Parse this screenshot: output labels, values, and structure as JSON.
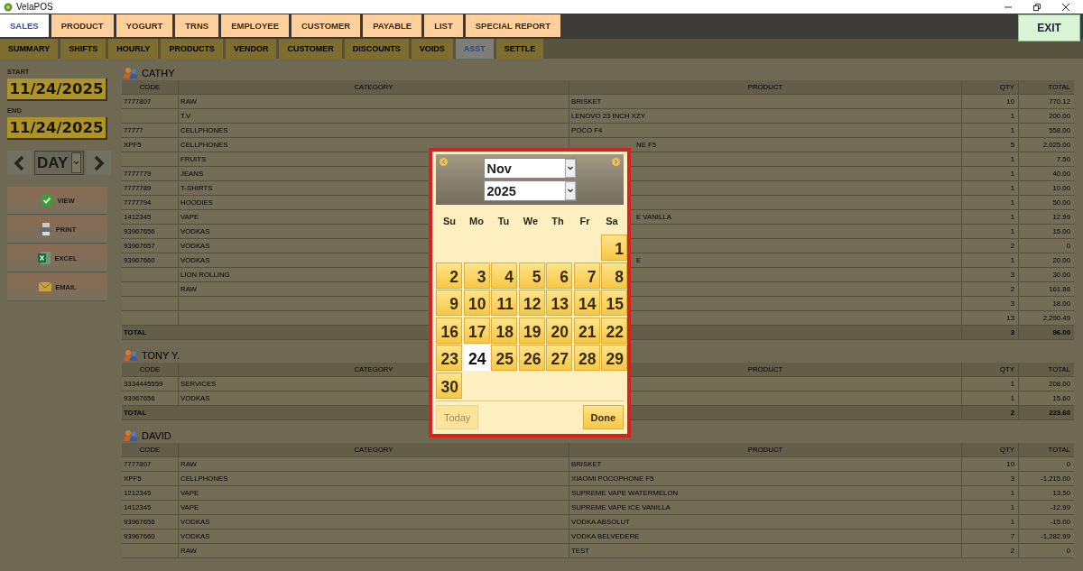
{
  "window": {
    "title": "VelaPOS"
  },
  "main_tabs": [
    {
      "label": "SALES",
      "selected": true
    },
    {
      "label": "PRODUCT",
      "selected": false
    },
    {
      "label": "YOGURT",
      "selected": false
    },
    {
      "label": "TRNS",
      "selected": false
    },
    {
      "label": "EMPLOYEE",
      "selected": false
    },
    {
      "label": "CUSTOMER",
      "selected": false
    },
    {
      "label": "PAYABLE",
      "selected": false
    },
    {
      "label": "LIST",
      "selected": false
    },
    {
      "label": "SPECIAL REPORT",
      "selected": false
    }
  ],
  "exit_button": "EXIT",
  "report_tabs": [
    {
      "label": "SUMMARY",
      "selected": false
    },
    {
      "label": "SHIFTS",
      "selected": false
    },
    {
      "label": "HOURLY",
      "selected": false
    },
    {
      "label": "PRODUCTS",
      "selected": false
    },
    {
      "label": "VENDOR",
      "selected": false
    },
    {
      "label": "CUSTOMER",
      "selected": false
    },
    {
      "label": "DISCOUNTS",
      "selected": false
    },
    {
      "label": "VOIDS",
      "selected": false
    },
    {
      "label": "ASST",
      "selected": true
    },
    {
      "label": "SETTLE",
      "selected": false
    }
  ],
  "sidebar": {
    "start_label": "START",
    "start_date": "11/24/2025",
    "end_label": "END",
    "end_date": "11/24/2025",
    "period": "DAY",
    "actions": [
      {
        "label": "VIEW",
        "kind": "view"
      },
      {
        "label": "PRINT",
        "kind": "print"
      },
      {
        "label": "EXCEL",
        "kind": "excel"
      },
      {
        "label": "EMAIL",
        "kind": "email"
      }
    ]
  },
  "groups": [
    {
      "name": "CATHY",
      "columns": [
        "CODE",
        "CATEGORY",
        "PRODUCT",
        "QTY",
        "TOTAL"
      ],
      "rows": [
        [
          "7777807",
          "RAW",
          "BRISKET",
          "10",
          "770.12"
        ],
        [
          "",
          "T.V",
          "LENOVO 23 INCH XZY",
          "1",
          "200.00"
        ],
        [
          "77777",
          "CELLPHONES",
          "POCO F4",
          "1",
          "558.00"
        ],
        [
          "XPF5",
          "CELLPHONES",
          "NE F5",
          "5",
          "2,025.00"
        ],
        [
          "",
          "FRUITS",
          "",
          "1",
          "7.50"
        ],
        [
          "7777779",
          "JEANS",
          "",
          "1",
          "40.00"
        ],
        [
          "7777789",
          "T-SHIRTS",
          "",
          "1",
          "10.00"
        ],
        [
          "7777794",
          "HOODIES",
          "",
          "1",
          "50.00"
        ],
        [
          "1412345",
          "VAPE",
          "E VANILLA",
          "1",
          "12.99"
        ],
        [
          "93967656",
          "VODKAS",
          "",
          "1",
          "15.00"
        ],
        [
          "93967657",
          "VODKAS",
          "",
          "2",
          "0"
        ],
        [
          "93967660",
          "VODKAS",
          "E",
          "1",
          "20.00"
        ],
        [
          "",
          "LION ROLLING",
          "",
          "3",
          "30.00"
        ],
        [
          "",
          "RAW",
          "",
          "2",
          "161.88"
        ],
        [
          "",
          "",
          "",
          "3",
          "18.00"
        ],
        [
          "",
          "",
          "",
          "13",
          "2,290.49"
        ]
      ],
      "total": {
        "label": "TOTAL",
        "qty": "3",
        "amount": "96.00"
      }
    },
    {
      "name": "TONY Y.",
      "columns": [
        "CODE",
        "CATEGORY",
        "PRODUCT",
        "QTY",
        "TOTAL"
      ],
      "rows": [
        [
          "3334445559",
          "SERVICES",
          "",
          "1",
          "208.00"
        ],
        [
          "93967656",
          "VODKAS",
          "",
          "1",
          "15.60"
        ]
      ],
      "total": {
        "label": "TOTAL",
        "qty": "2",
        "amount": "223.60"
      }
    },
    {
      "name": "DAVID",
      "columns": [
        "CODE",
        "CATEGORY",
        "PRODUCT",
        "QTY",
        "TOTAL"
      ],
      "rows": [
        [
          "7777807",
          "RAW",
          "BRISKET",
          "10",
          "0"
        ],
        [
          "XPF5",
          "CELLPHONES",
          "XIAOMI POCOPHONE F5",
          "3",
          "-1,215.00"
        ],
        [
          "1212345",
          "VAPE",
          "SUPREME VAPE WATERMELON",
          "1",
          "13.50"
        ],
        [
          "1412345",
          "VAPE",
          "SUPREME VAPE ICE VANILLA",
          "1",
          "-12.99"
        ],
        [
          "93967656",
          "VODKAS",
          "VODKA ABSOLUT",
          "1",
          "-15.00"
        ],
        [
          "93967660",
          "VODKAS",
          "VODKA BELVEDERE",
          "7",
          "-1,282.99"
        ],
        [
          "",
          "RAW",
          "TEST",
          "2",
          "0"
        ]
      ]
    }
  ],
  "datepicker": {
    "month": "Nov",
    "year": "2025",
    "weekdays": [
      "Su",
      "Mo",
      "Tu",
      "We",
      "Th",
      "Fr",
      "Sa"
    ],
    "weeks": [
      {
        "kind": "tail",
        "days": [
          {
            "label": "1",
            "selected": false
          }
        ]
      },
      {
        "kind": "full",
        "days": [
          {
            "label": "2",
            "selected": false
          },
          {
            "label": "3",
            "selected": false
          },
          {
            "label": "4",
            "selected": false
          },
          {
            "label": "5",
            "selected": false
          },
          {
            "label": "6",
            "selected": false
          },
          {
            "label": "7",
            "selected": false
          },
          {
            "label": "8",
            "selected": false
          }
        ]
      },
      {
        "kind": "full",
        "days": [
          {
            "label": "9",
            "selected": false
          },
          {
            "label": "10",
            "selected": false
          },
          {
            "label": "11",
            "selected": false
          },
          {
            "label": "12",
            "selected": false
          },
          {
            "label": "13",
            "selected": false
          },
          {
            "label": "14",
            "selected": false
          },
          {
            "label": "15",
            "selected": false
          }
        ]
      },
      {
        "kind": "full",
        "days": [
          {
            "label": "16",
            "selected": false
          },
          {
            "label": "17",
            "selected": false
          },
          {
            "label": "18",
            "selected": false
          },
          {
            "label": "19",
            "selected": false
          },
          {
            "label": "20",
            "selected": false
          },
          {
            "label": "21",
            "selected": false
          },
          {
            "label": "22",
            "selected": false
          }
        ]
      },
      {
        "kind": "full",
        "days": [
          {
            "label": "23",
            "selected": false
          },
          {
            "label": "24",
            "selected": true
          },
          {
            "label": "25",
            "selected": false
          },
          {
            "label": "26",
            "selected": false
          },
          {
            "label": "27",
            "selected": false
          },
          {
            "label": "28",
            "selected": false
          },
          {
            "label": "29",
            "selected": false
          }
        ]
      },
      {
        "kind": "head",
        "days": [
          {
            "label": "30",
            "selected": false
          }
        ]
      }
    ],
    "today_button": {
      "label": "Today",
      "disabled": true
    },
    "done_button": "Done"
  }
}
